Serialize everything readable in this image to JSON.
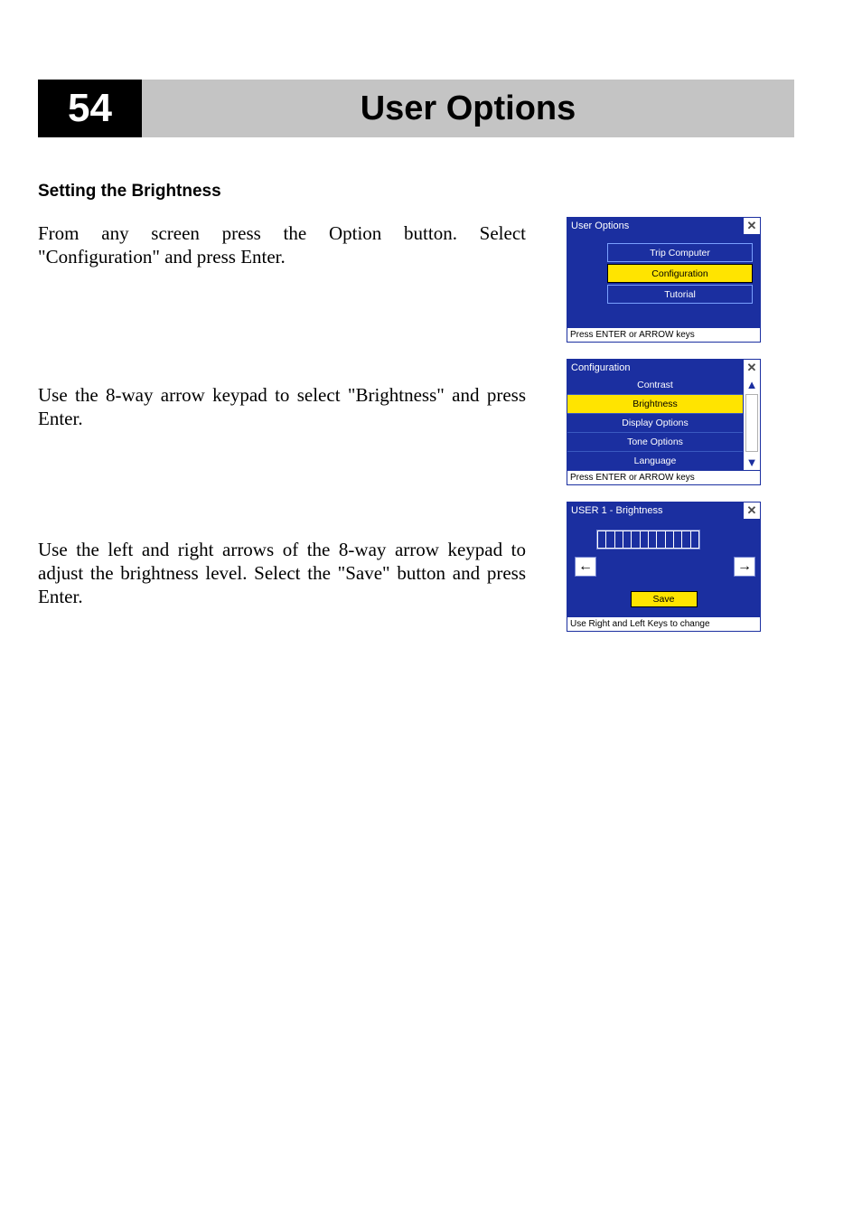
{
  "header": {
    "page_number": "54",
    "title": "User Options"
  },
  "section_title": "Setting the Brightness",
  "paragraphs": {
    "p1": "From any screen press the Option button. Select \"Configuration\" and press Enter.",
    "p2": "Use the 8-way arrow keypad to select \"Brightness\" and press Enter.",
    "p3": "Use the left and right arrows of the 8-way arrow keypad to adjust the brightness level. Select the \"Save\" button and press Enter."
  },
  "fig1": {
    "title": "User Options",
    "close": "✕",
    "items": [
      "Trip Computer",
      "Configuration",
      "Tutorial"
    ],
    "selected_index": 1,
    "status": "Press ENTER or ARROW keys"
  },
  "fig2": {
    "title": "Configuration",
    "close": "✕",
    "up": "▲",
    "down": "▼",
    "items": [
      "Contrast",
      "Brightness",
      "Display Options",
      "Tone Options",
      "Language"
    ],
    "selected_index": 1,
    "status": "Press ENTER or ARROW keys"
  },
  "fig3": {
    "title": "USER 1 - Brightness",
    "close": "✕",
    "left": "←",
    "right": "→",
    "slider_ticks": 12,
    "save": "Save",
    "status": "Use Right and Left Keys to change"
  }
}
